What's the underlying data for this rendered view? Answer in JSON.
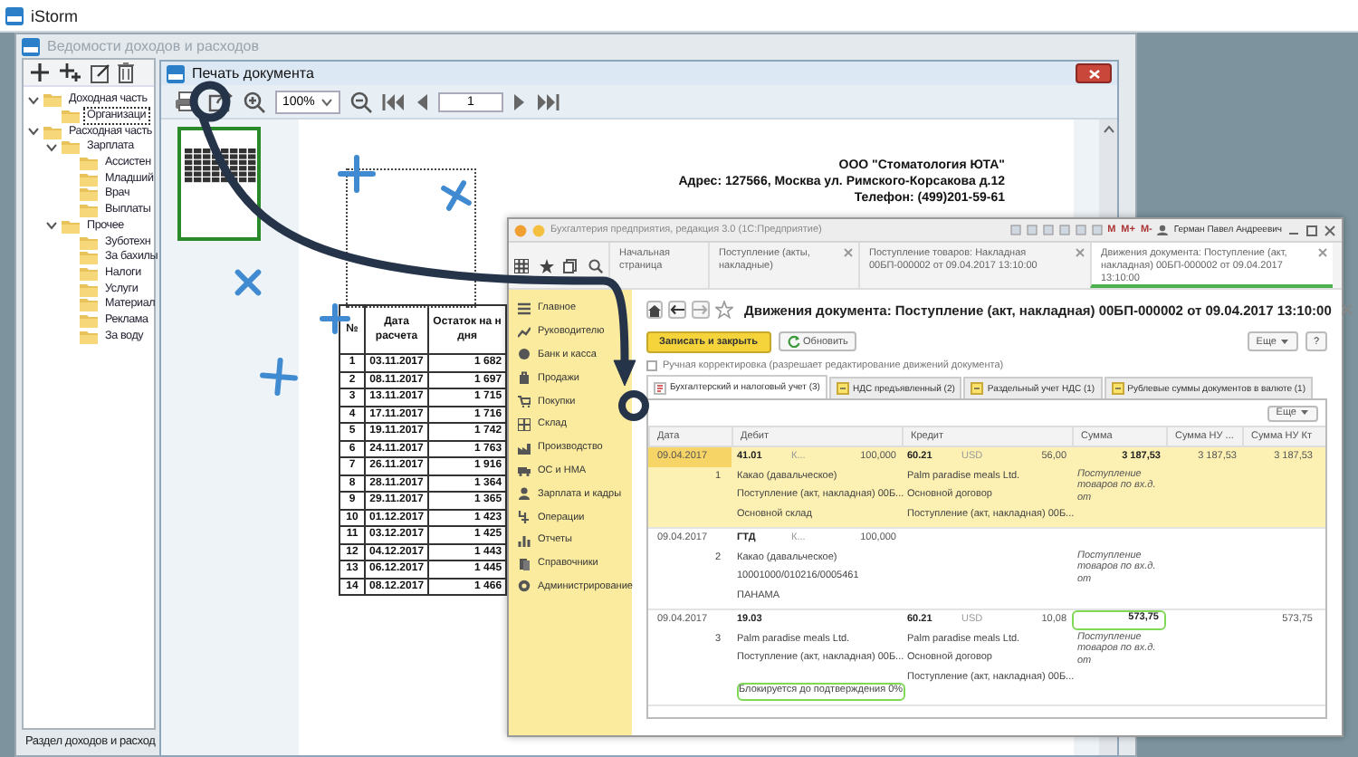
{
  "app": {
    "title": "iStorm"
  },
  "ledger_window": {
    "title": "Ведомости доходов и расходов",
    "tree": [
      {
        "label": "Доходная часть",
        "expanded": true,
        "selected": false,
        "children": [
          {
            "label": "Организаци",
            "selected": true
          }
        ]
      },
      {
        "label": "Расходная часть",
        "expanded": true,
        "selected": false,
        "children": [
          {
            "label": "Зарплата",
            "expanded": true,
            "selected": false,
            "children": [
              {
                "label": "Ассистен",
                "selected": false
              },
              {
                "label": "Младший",
                "selected": false
              },
              {
                "label": "Врач",
                "selected": false
              },
              {
                "label": "Выплаты",
                "selected": false
              }
            ]
          },
          {
            "label": "Прочее",
            "expanded": true,
            "selected": false,
            "children": [
              {
                "label": "Зуботехн",
                "selected": false
              },
              {
                "label": "За бахилы",
                "selected": false
              },
              {
                "label": "Налоги",
                "selected": false
              },
              {
                "label": "Услуги",
                "selected": false
              },
              {
                "label": "Материал",
                "selected": false
              },
              {
                "label": "Реклама",
                "selected": false
              },
              {
                "label": "За воду",
                "selected": false
              }
            ]
          }
        ]
      }
    ],
    "status_bar": "Раздел доходов и расход"
  },
  "print_window": {
    "title": "Печать документа",
    "zoom": "100%",
    "page": "1",
    "document": {
      "header_lines": [
        "ООО \"Стоматология ЮТА\"",
        "Адрес: 127566, Москва ул. Римского-Корсакова д.12",
        "Телефон: (499)201-59-61"
      ],
      "table": {
        "columns": [
          "№",
          "Дата расчета",
          "Остаток на н\nдня"
        ],
        "rows": [
          [
            "1",
            "03.11.2017",
            "1 682"
          ],
          [
            "2",
            "08.11.2017",
            "1 697"
          ],
          [
            "3",
            "13.11.2017",
            "1 715"
          ],
          [
            "4",
            "17.11.2017",
            "1 716"
          ],
          [
            "5",
            "19.11.2017",
            "1 742"
          ],
          [
            "6",
            "24.11.2017",
            "1 763"
          ],
          [
            "7",
            "26.11.2017",
            "1 916"
          ],
          [
            "8",
            "28.11.2017",
            "1 364"
          ],
          [
            "9",
            "29.11.2017",
            "1 365"
          ],
          [
            "10",
            "01.12.2017",
            "1 423"
          ],
          [
            "11",
            "03.12.2017",
            "1 425"
          ],
          [
            "12",
            "04.12.2017",
            "1 443"
          ],
          [
            "13",
            "06.12.2017",
            "1 445"
          ],
          [
            "14",
            "08.12.2017",
            "1 466"
          ]
        ]
      }
    }
  },
  "accounting_window": {
    "title": "Бухгалтерия предприятия, редакция 3.0 (1С:Предприятие)",
    "memory_buttons": [
      "M",
      "M+",
      "M-"
    ],
    "user": "Герман Павел Андреевич",
    "tabs": [
      {
        "label": "Начальная страница",
        "closable": false,
        "selected": false
      },
      {
        "label": "Поступление (акты, накладные)",
        "closable": true,
        "selected": false
      },
      {
        "label": "Поступление товаров: Накладная 00БП-000002 от 09.04.2017 13:10:00",
        "closable": true,
        "selected": false
      },
      {
        "label": "Движения документа: Поступление (акт, накладная) 00БП-000002 от 09.04.2017 13:10:00",
        "closable": true,
        "selected": true
      }
    ],
    "sections": [
      "Главное",
      "Руководителю",
      "Банк и касса",
      "Продажи",
      "Покупки",
      "Склад",
      "Производство",
      "ОС и НМА",
      "Зарплата и кадры",
      "Операции",
      "Отчеты",
      "Справочники",
      "Администрирование"
    ],
    "document": {
      "title": "Движения документа: Поступление (акт, накладная) 00БП-000002 от 09.04.2017 13:10:00",
      "save_button": "Записать и закрыть",
      "refresh_button": "Обновить",
      "more_button": "Еще",
      "help_button": "?",
      "manual_adjustment": {
        "label": "Ручная корректировка (разрешает редактирование движений документа)",
        "checked": false
      },
      "register_tabs": [
        {
          "label": "Бухгалтерский и налоговый учет (3)",
          "selected": true
        },
        {
          "label": "НДС предъявленный (2)",
          "selected": false
        },
        {
          "label": "Раздельный учет НДС (1)",
          "selected": false
        },
        {
          "label": "Рублевые суммы документов в валюте (1)",
          "selected": false
        }
      ],
      "table_more_button": "Еще",
      "table": {
        "columns": [
          "Дата",
          "Дебит",
          "Кредит",
          "Сумма",
          "Сумма НУ ...",
          "Сумма НУ Кт"
        ],
        "rows": [
          {
            "selected": true,
            "date": "09.04.2017",
            "number": "1",
            "debit": {
              "account": "41.01",
              "qty_label": "К...",
              "quantity": "100,000",
              "lines": [
                {
                  "text": "Какао (давальческое)",
                  "highlighted": false
                },
                {
                  "text": "Поступление (акт, накладная) 00Б...",
                  "highlighted": false
                },
                {
                  "text": "Основной склад",
                  "highlighted": false
                }
              ]
            },
            "credit": {
              "account": "60.21",
              "currency": "USD",
              "amount": "56,00",
              "lines": [
                {
                  "text": "Palm paradise meals Ltd.",
                  "highlighted": false
                },
                {
                  "text": "Основной договор",
                  "highlighted": false
                },
                {
                  "text": "Поступление (акт, накладная) 00Б...",
                  "highlighted": false
                }
              ]
            },
            "sum": "3 187,53",
            "sum_highlighted": false,
            "sum_note": "Поступление товаров по вх.д. от",
            "sum_nu_dt": "3 187,53",
            "sum_nu_kt": "3 187,53"
          },
          {
            "selected": false,
            "date": "09.04.2017",
            "number": "2",
            "debit": {
              "account": "ГТД",
              "qty_label": "К...",
              "quantity": "100,000",
              "lines": [
                {
                  "text": "Какао (давальческое)",
                  "highlighted": false
                },
                {
                  "text": "10001000/010216/0005461",
                  "highlighted": false
                },
                {
                  "text": "ПАНАМА",
                  "highlighted": false
                }
              ]
            },
            "sum_note": "Поступление товаров по вх.д. от"
          },
          {
            "selected": false,
            "date": "09.04.2017",
            "number": "3",
            "debit": {
              "account": "19.03",
              "lines": [
                {
                  "text": "Palm paradise meals Ltd.",
                  "highlighted": false
                },
                {
                  "text": "Поступление (акт, накладная) 00Б...",
                  "highlighted": false
                },
                {
                  "text": "Блокируется до подтверждения 0%",
                  "highlighted": true
                }
              ]
            },
            "credit": {
              "account": "60.21",
              "currency": "USD",
              "amount": "10,08",
              "lines": [
                {
                  "text": "Palm paradise meals Ltd.",
                  "highlighted": false
                },
                {
                  "text": "Основной договор",
                  "highlighted": false
                },
                {
                  "text": "Поступление (акт, накладная) 00Б...",
                  "highlighted": false
                }
              ]
            },
            "sum": "573,75",
            "sum_highlighted": true,
            "sum_note": "Поступление товаров по вх.д. от",
            "sum_nu_kt": "573,75"
          }
        ]
      }
    }
  }
}
